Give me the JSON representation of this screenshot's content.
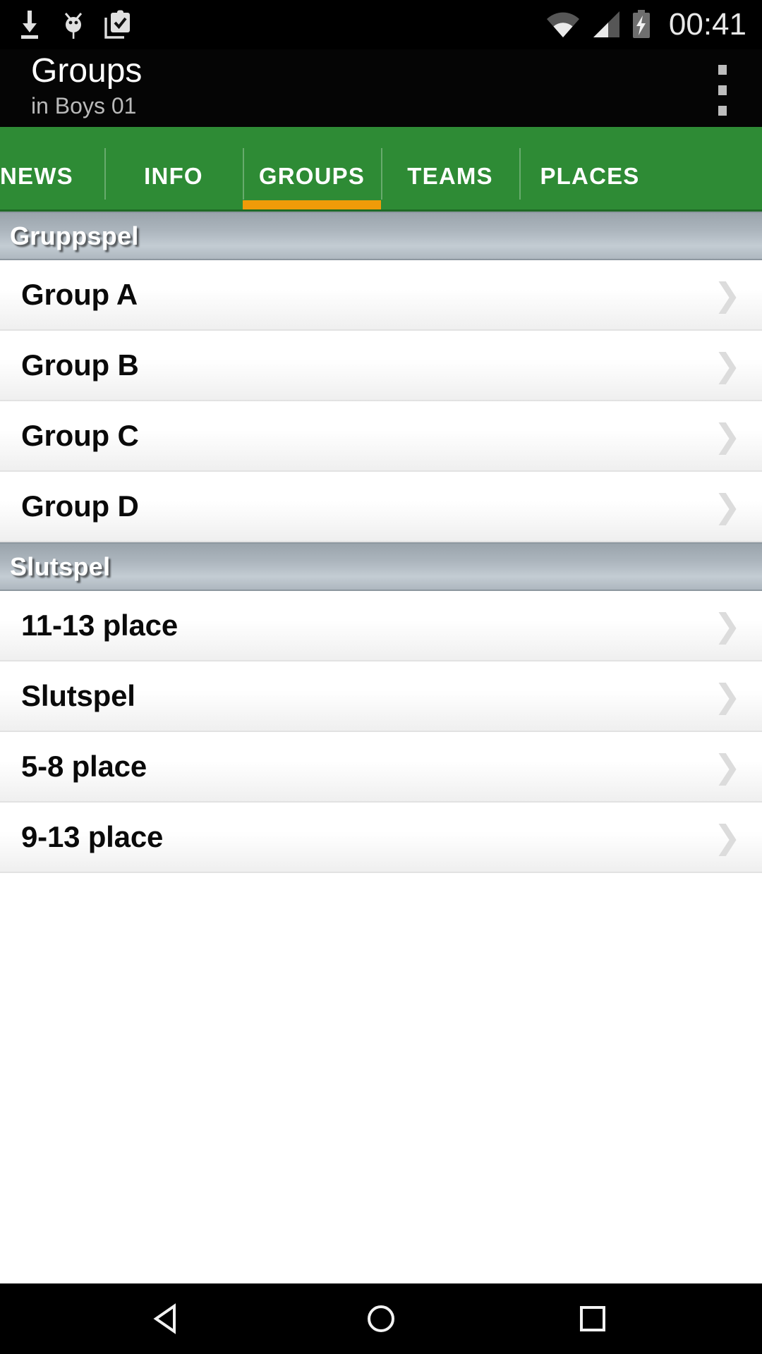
{
  "statusbar": {
    "time": "00:41",
    "left_icons": [
      "download-icon",
      "android-debug-icon",
      "clipboard-check-icon"
    ],
    "right_icons": [
      "wifi-icon",
      "cellular-signal-icon",
      "battery-charging-icon"
    ]
  },
  "actionbar": {
    "title": "Groups",
    "subtitle": "in Boys 01",
    "overflow_icon": "overflow-menu-icon"
  },
  "tabs": {
    "accent_color": "#f09b09",
    "bar_color": "#2e8b35",
    "items": [
      {
        "label": "NEWS",
        "active": false
      },
      {
        "label": "INFO",
        "active": false
      },
      {
        "label": "GROUPS",
        "active": true
      },
      {
        "label": "TEAMS",
        "active": false
      },
      {
        "label": "PLACES",
        "active": false
      }
    ]
  },
  "list": {
    "chevron_glyph": "❯",
    "sections": [
      {
        "header": "Gruppspel",
        "rows": [
          {
            "label": "Group A"
          },
          {
            "label": "Group B"
          },
          {
            "label": "Group C"
          },
          {
            "label": "Group D"
          }
        ]
      },
      {
        "header": "Slutspel",
        "rows": [
          {
            "label": "11-13 place"
          },
          {
            "label": "Slutspel"
          },
          {
            "label": "5-8 place"
          },
          {
            "label": "9-13 place"
          }
        ]
      }
    ]
  },
  "navbar": {
    "back_icon": "back-triangle-icon",
    "home_icon": "home-circle-icon",
    "recents_icon": "recents-square-icon"
  }
}
